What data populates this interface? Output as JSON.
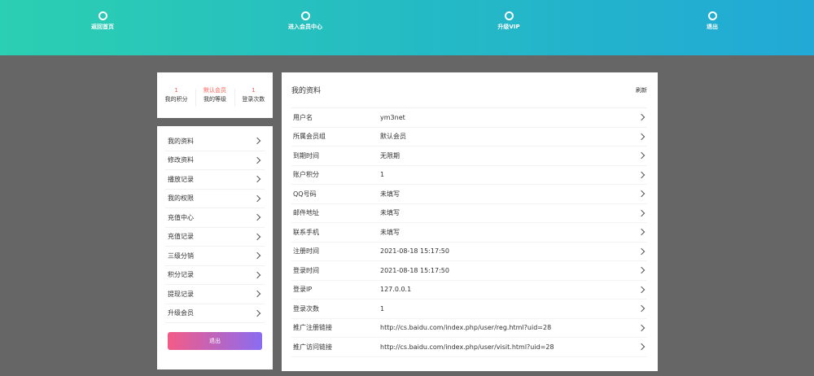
{
  "topnav": {
    "items": [
      {
        "label": "返回首页"
      },
      {
        "label": "进入会员中心"
      },
      {
        "label": "升级VIP"
      },
      {
        "label": "退出"
      }
    ]
  },
  "stats": [
    {
      "value": "1",
      "label": "我的积分"
    },
    {
      "value": "默认会员",
      "label": "我的等级"
    },
    {
      "value": "1",
      "label": "登录次数"
    }
  ],
  "sidebar": {
    "items": [
      {
        "label": "我的资料"
      },
      {
        "label": "修改资料"
      },
      {
        "label": "播放记录"
      },
      {
        "label": "我的权限"
      },
      {
        "label": "充值中心"
      },
      {
        "label": "充值记录"
      },
      {
        "label": "三级分销"
      },
      {
        "label": "积分记录"
      },
      {
        "label": "提现记录"
      },
      {
        "label": "升级会员"
      }
    ],
    "logout_label": "退出"
  },
  "profile": {
    "title": "我的资料",
    "refresh_label": "刷新",
    "rows": [
      {
        "key": "用户名",
        "value": "ym3net"
      },
      {
        "key": "所属会员组",
        "value": "默认会员"
      },
      {
        "key": "到期时间",
        "value": "无限期"
      },
      {
        "key": "账户积分",
        "value": "1"
      },
      {
        "key": "QQ号码",
        "value": "未填写"
      },
      {
        "key": "邮件地址",
        "value": "未填写"
      },
      {
        "key": "联系手机",
        "value": "未填写"
      },
      {
        "key": "注册时间",
        "value": "2021-08-18 15:17:50"
      },
      {
        "key": "登录时间",
        "value": "2021-08-18 15:17:50"
      },
      {
        "key": "登录IP",
        "value": "127.0.0.1"
      },
      {
        "key": "登录次数",
        "value": "1"
      },
      {
        "key": "推广注册链接",
        "value": "http://cs.baidu.com/index.php/user/reg.html?uid=28"
      },
      {
        "key": "推广访问链接",
        "value": "http://cs.baidu.com/index.php/user/visit.html?uid=28"
      }
    ]
  },
  "colors": {
    "nav_gradient_start": "#2bcfb1",
    "nav_gradient_end": "#22a9d6",
    "page_background": "#666666",
    "stat_value": "#ff5a4f",
    "logout_gradient_start": "#f35b86",
    "logout_gradient_end": "#8a6cf1"
  },
  "icons": {
    "nav": "circle-icon",
    "row": "chevron-right-icon"
  }
}
